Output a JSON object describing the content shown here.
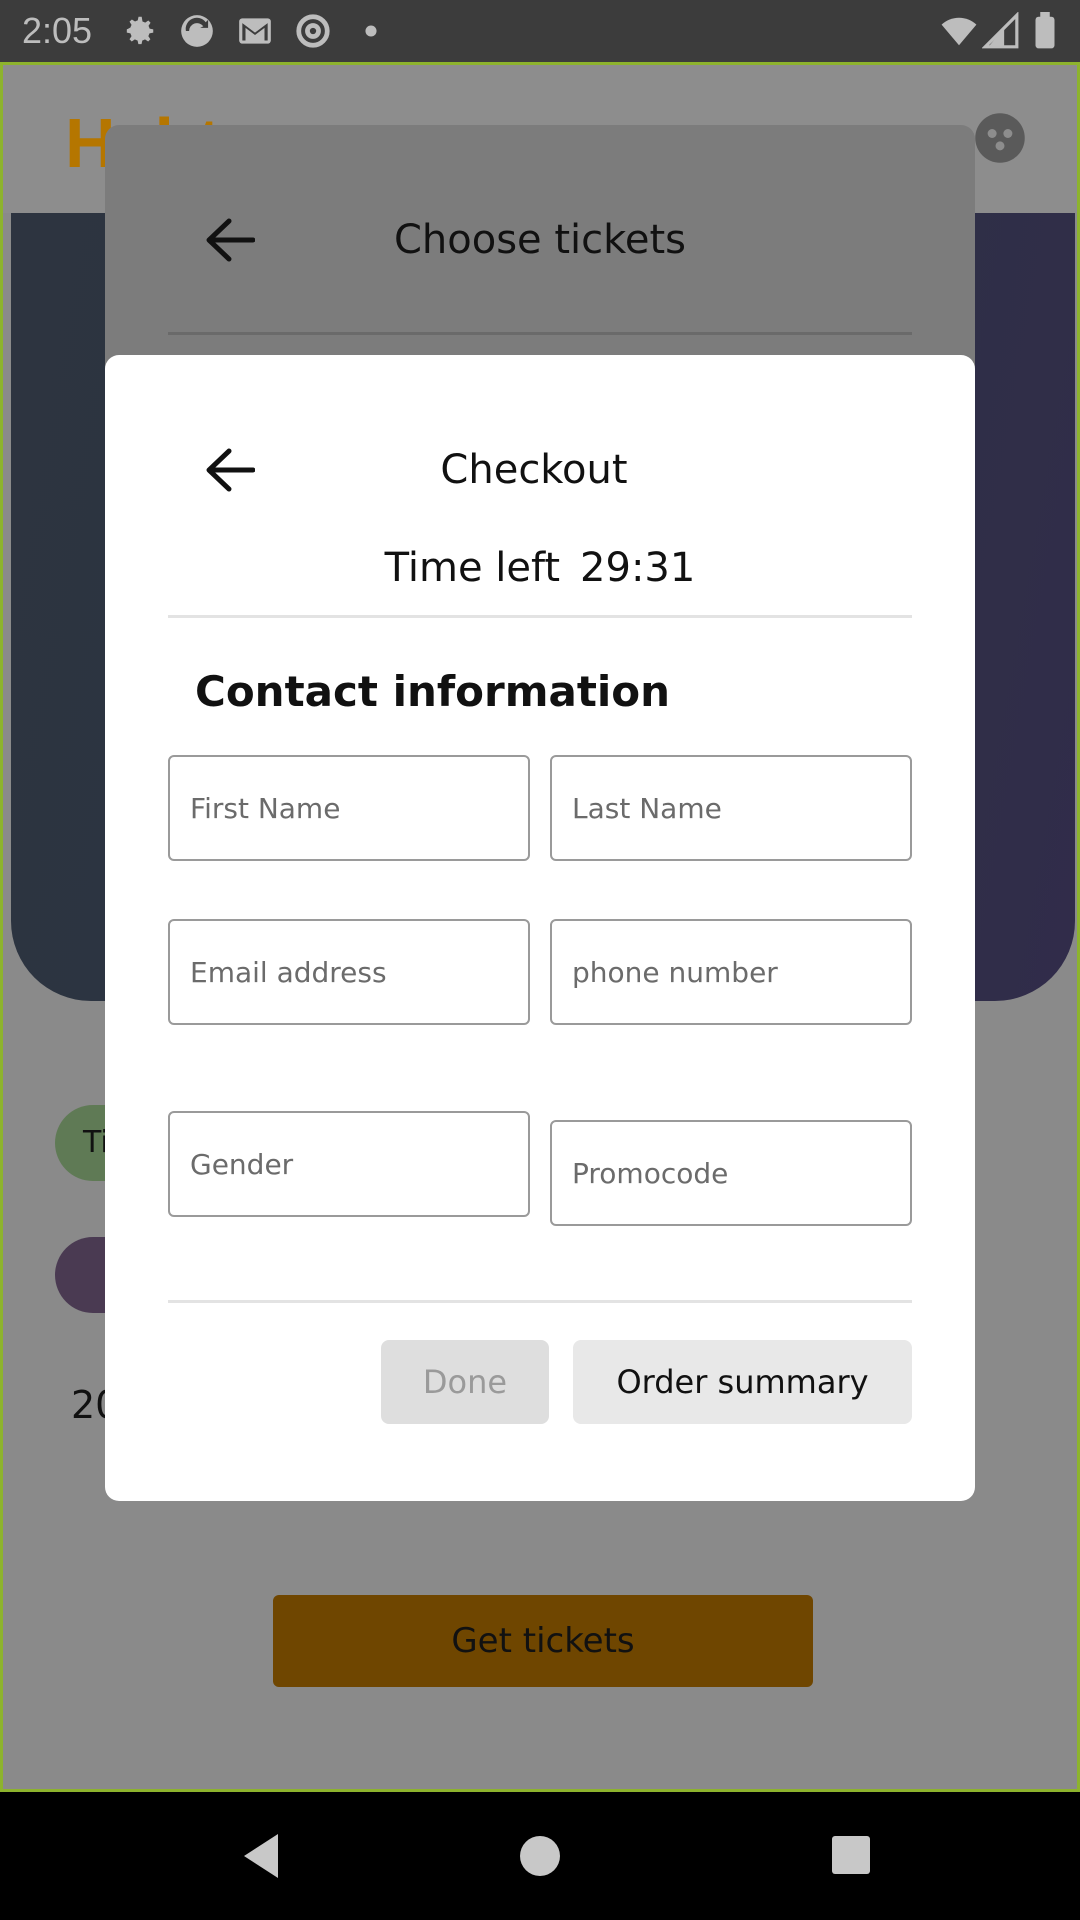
{
  "status_bar": {
    "time": "2:05",
    "left_icons": [
      "gear-icon",
      "sync-icon",
      "gmail-icon",
      "at-sign-icon",
      "dot-icon"
    ],
    "right_icons": [
      "wifi-icon",
      "signal-icon",
      "battery-icon"
    ]
  },
  "background_app": {
    "logo": "Habtu",
    "chip_text": "Ti",
    "year_text": "20",
    "get_tickets_label": "Get tickets"
  },
  "choose_tickets_dialog": {
    "title": "Choose tickets"
  },
  "checkout_dialog": {
    "title": "Checkout",
    "time_left_label": "Time left",
    "time_left_value": "29:31",
    "section_title": "Contact information",
    "fields": {
      "first_name": {
        "placeholder": "First Name",
        "value": ""
      },
      "last_name": {
        "placeholder": "Last Name",
        "value": ""
      },
      "email": {
        "placeholder": "Email address",
        "value": ""
      },
      "phone": {
        "placeholder": "phone number",
        "value": ""
      },
      "gender": {
        "placeholder": "Gender",
        "value": ""
      },
      "promocode": {
        "placeholder": "Promocode",
        "value": ""
      }
    },
    "done_label": "Done",
    "order_summary_label": "Order summary"
  },
  "nav_bar": {
    "icons": [
      "back-triangle-icon",
      "home-circle-icon",
      "recents-square-icon"
    ]
  },
  "colors": {
    "accent": "#b57600",
    "frame_border": "#8db32d",
    "modal_bg": "#ffffff",
    "done_disabled_bg": "#dedede"
  }
}
